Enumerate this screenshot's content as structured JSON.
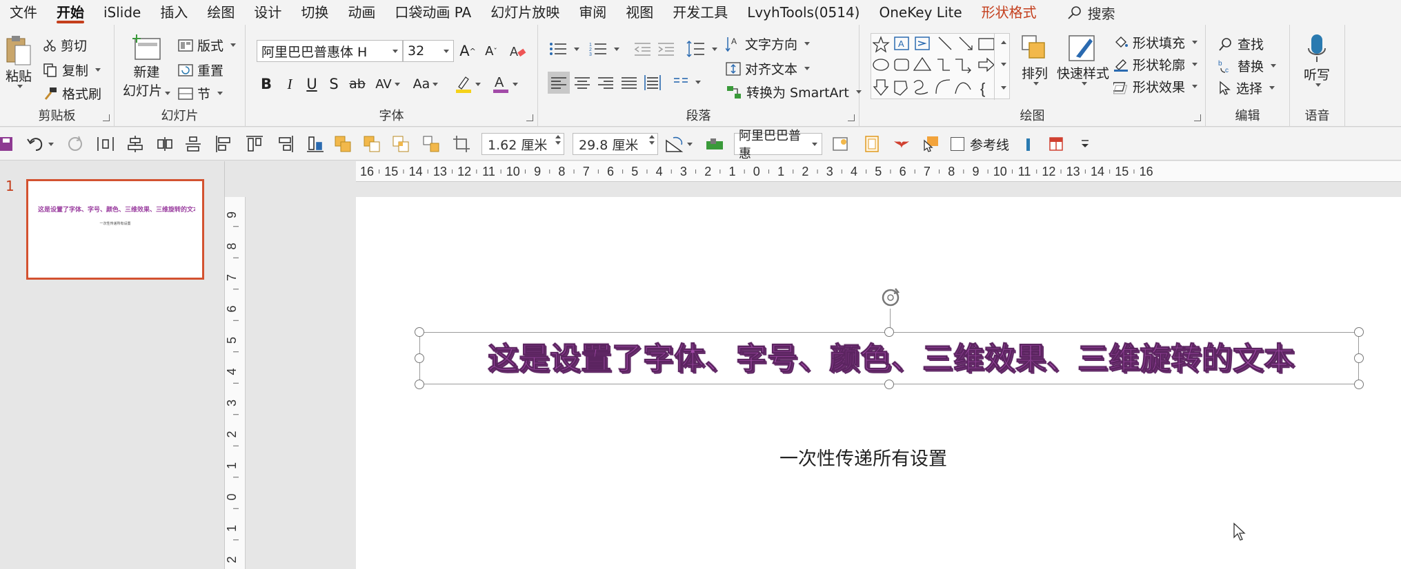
{
  "menu": {
    "items": [
      "文件",
      "开始",
      "iSlide",
      "插入",
      "绘图",
      "设计",
      "切换",
      "动画",
      "口袋动画 PA",
      "幻灯片放映",
      "审阅",
      "视图",
      "开发工具",
      "LvyhTools(0514)",
      "OneKey Lite",
      "形状格式"
    ],
    "active": "开始",
    "search": "搜索"
  },
  "ribbon": {
    "clipboard": {
      "label": "剪贴板",
      "paste": "粘贴",
      "cut": "剪切",
      "copy": "复制",
      "format_painter": "格式刷"
    },
    "slides": {
      "label": "幻灯片",
      "new_slide_1": "新建",
      "new_slide_2": "幻灯片",
      "layout": "版式",
      "reset": "重置",
      "section": "节"
    },
    "font": {
      "label": "字体",
      "family": "阿里巴巴普惠体 H",
      "size": "32",
      "bold": "B",
      "italic": "I",
      "underline": "U",
      "shadow": "S",
      "strike": "ab",
      "spacing": "AV",
      "case": "Aa",
      "grow": "A",
      "shrink": "A"
    },
    "paragraph": {
      "label": "段落",
      "text_direction": "文字方向",
      "align_text": "对齐文本",
      "smartart": "转换为 SmartArt"
    },
    "drawing": {
      "label": "绘图",
      "arrange": "排列",
      "quick_styles": "快速样式",
      "shape_fill": "形状填充",
      "shape_outline": "形状轮廓",
      "shape_effects": "形状效果"
    },
    "editing": {
      "label": "编辑",
      "find": "查找",
      "replace": "替换",
      "select": "选择"
    },
    "voice": {
      "label": "语音",
      "dictate": "听写"
    }
  },
  "quickbar": {
    "height": "1.62 厘米",
    "width": "29.8 厘米",
    "font": "阿里巴巴普惠",
    "guides": "参考线"
  },
  "rulers": {
    "horizontal": [
      "16",
      "15",
      "14",
      "13",
      "12",
      "11",
      "10",
      "9",
      "8",
      "7",
      "6",
      "5",
      "4",
      "3",
      "2",
      "1",
      "0",
      "1",
      "2",
      "3",
      "4",
      "5",
      "6",
      "7",
      "8",
      "9",
      "10",
      "11",
      "12",
      "13",
      "14",
      "15",
      "16"
    ],
    "vertical": [
      "9",
      "8",
      "7",
      "6",
      "5",
      "4",
      "3",
      "2",
      "1",
      "0",
      "1",
      "2"
    ]
  },
  "thumbnails": [
    {
      "number": "1",
      "title": "这是设置了字体、字号、颜色、三维效果、三维旋转的文本",
      "subtitle": "一次性传递所有设置"
    }
  ],
  "slide": {
    "headline": "这是设置了字体、字号、颜色、三维效果、三维旋转的文本",
    "subtitle": "一次性传递所有设置"
  },
  "colors": {
    "accent": "#c43e1c",
    "headline": "#a24aa8",
    "thumb_border": "#d35230"
  }
}
